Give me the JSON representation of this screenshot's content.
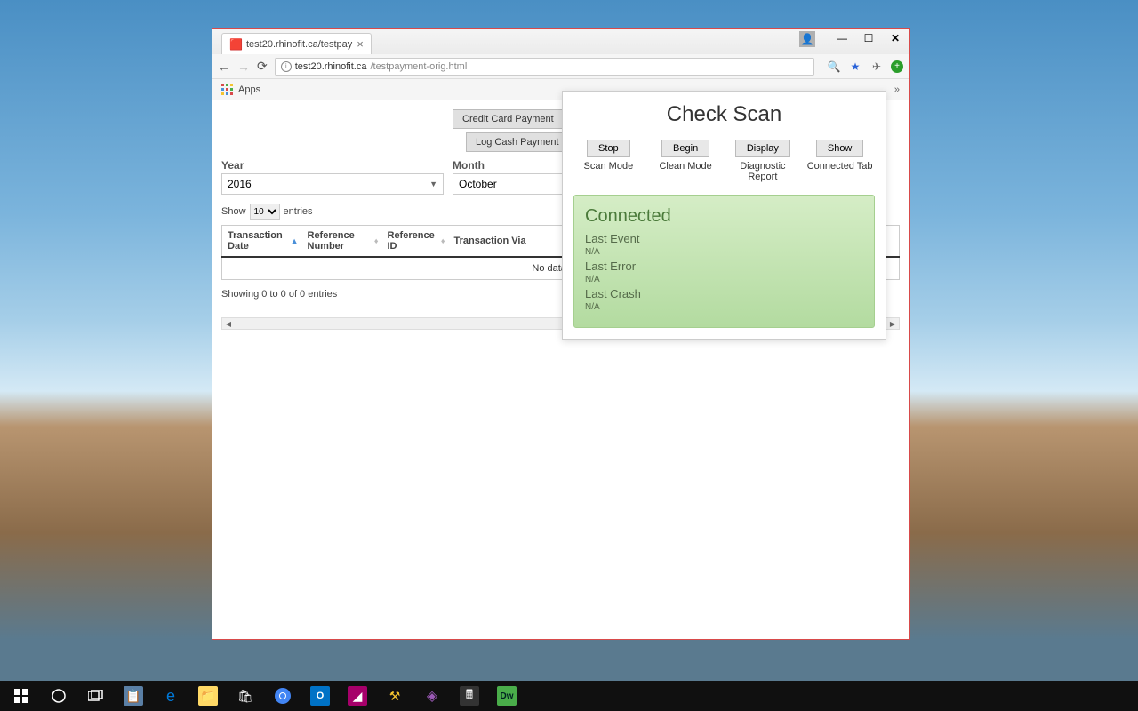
{
  "browser": {
    "tab_title": "test20.rhinofit.ca/testpay",
    "url_domain": "test20.rhinofit.ca",
    "url_path": "/testpayment-orig.html",
    "apps_label": "Apps"
  },
  "page": {
    "credit_btn": "Credit Card Payment",
    "cash_btn": "Log Cash Payment",
    "year_label": "Year",
    "year_value": "2016",
    "month_label": "Month",
    "month_value": "October",
    "show_label": "Show",
    "show_value": "10",
    "entries_label": "entries",
    "columns": [
      "Transaction Date",
      "Reference Number",
      "Reference ID",
      "Transaction Via"
    ],
    "no_data": "No data avail",
    "table_info": "Showing 0 to 0 of 0 entries"
  },
  "popup": {
    "title": "Check Scan",
    "buttons": [
      {
        "label": "Stop",
        "sub": "Scan Mode"
      },
      {
        "label": "Begin",
        "sub": "Clean Mode"
      },
      {
        "label": "Display",
        "sub": "Diagnostic Report"
      },
      {
        "label": "Show",
        "sub": "Connected Tab"
      }
    ],
    "status_title": "Connected",
    "fields": [
      {
        "label": "Last Event",
        "value": "N/A"
      },
      {
        "label": "Last Error",
        "value": "N/A"
      },
      {
        "label": "Last Crash",
        "value": "N/A"
      }
    ]
  }
}
